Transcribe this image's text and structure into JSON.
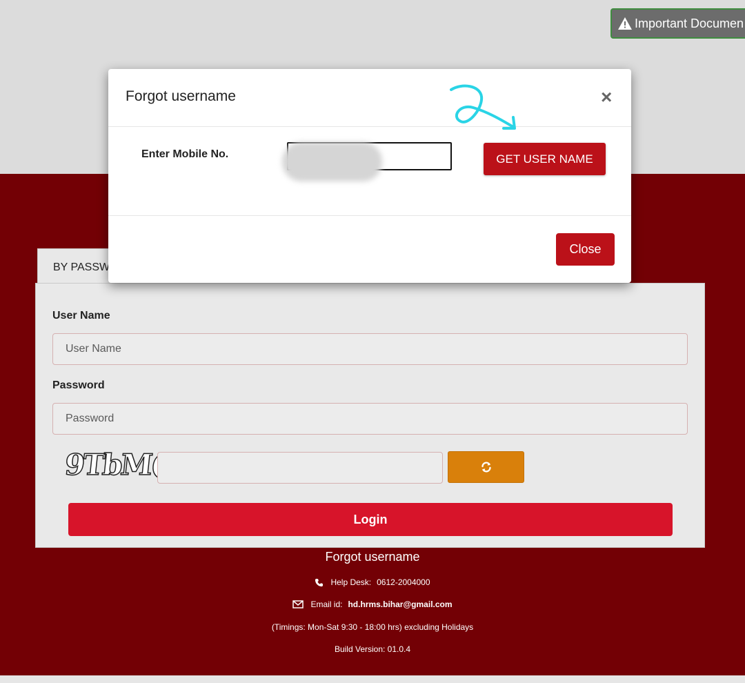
{
  "header": {
    "important_documents_label": "Important Documen"
  },
  "login_tabs": [
    {
      "label": "BY PASSWO"
    }
  ],
  "login_form": {
    "username_label": "User Name",
    "username_placeholder": "User Name",
    "password_label": "Password",
    "password_placeholder": "Password",
    "captcha_text": "9TbM(",
    "refresh_icon": "refresh-icon",
    "login_label": "Login"
  },
  "footer": {
    "forgot_username_link": "Forgot username",
    "helpdesk_label": "Help Desk:",
    "helpdesk_phone": "0612-2004000",
    "email_label": "Email id:",
    "email_value": "hd.hrms.bihar@gmail.com",
    "timings": "(Timings: Mon-Sat 9:30 - 18:00 hrs) excluding Holidays",
    "build_version": "Build Version: 01.0.4"
  },
  "modal": {
    "title": "Forgot username",
    "close_symbol": "×",
    "mobile_label": "Enter Mobile No.",
    "mobile_value": "",
    "get_username_label": "GET USER NAME",
    "close_label": "Close"
  },
  "colors": {
    "brand_red": "#730005",
    "button_red": "#bb1119",
    "login_red": "#d7142a",
    "refresh_orange": "#d9800b",
    "annotation_cyan": "#2ad4e6"
  }
}
